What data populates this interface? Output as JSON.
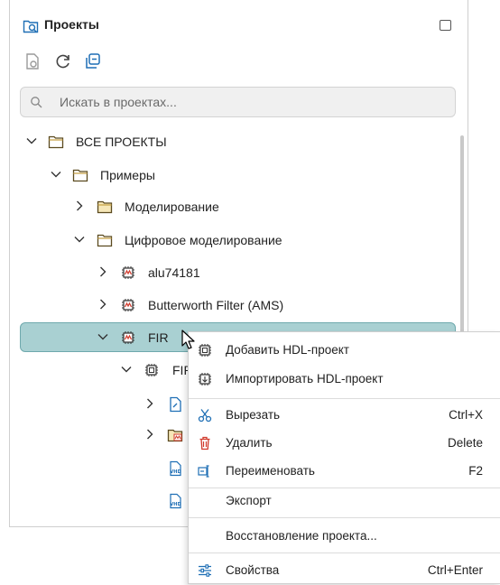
{
  "panel": {
    "title": "Проекты"
  },
  "search": {
    "placeholder": "Искать в проектах..."
  },
  "tree": [
    {
      "label": "ВСЕ ПРОЕКТЫ",
      "icon": "folder-icon",
      "expanded": true
    },
    {
      "label": "Примеры",
      "icon": "folder-icon",
      "expanded": true
    },
    {
      "label": "Моделирование",
      "icon": "folder-icon",
      "expanded": false
    },
    {
      "label": "Цифровое моделирование",
      "icon": "folder-icon",
      "expanded": true
    },
    {
      "label": "alu74181",
      "icon": "chip-wave-icon",
      "expanded": false
    },
    {
      "label": "Butterworth Filter  (AMS)",
      "icon": "chip-wave-icon",
      "expanded": false
    },
    {
      "label": "FIR",
      "icon": "chip-wave-icon",
      "expanded": true,
      "selected": true
    },
    {
      "label": "FIR",
      "icon": "chip-icon",
      "expanded": true
    },
    {
      "label": "",
      "icon": "document-icon",
      "expanded": false
    },
    {
      "label": "",
      "icon": "folder-wave-icon",
      "expanded": false
    },
    {
      "label": "",
      "icon": "vhd-file-icon"
    },
    {
      "label": "",
      "icon": "vhd-file-icon"
    }
  ],
  "context_menu": {
    "items": [
      {
        "label": "Добавить HDL-проект",
        "shortcut": "",
        "icon": "chip-add-icon"
      },
      {
        "label": "Импортировать HDL-проект",
        "shortcut": "",
        "icon": "chip-import-icon"
      },
      {
        "label": "Вырезать",
        "shortcut": "Ctrl+X",
        "icon": "scissors-icon"
      },
      {
        "label": "Удалить",
        "shortcut": "Delete",
        "icon": "trash-icon"
      },
      {
        "label": "Переименовать",
        "shortcut": "F2",
        "icon": "rename-icon"
      },
      {
        "label": "Экспорт",
        "shortcut": "",
        "icon": "",
        "submenu_arrow": "›"
      },
      {
        "label": "Восстановление проекта...",
        "shortcut": "",
        "icon": ""
      },
      {
        "label": "Свойства",
        "shortcut": "Ctrl+Enter",
        "icon": "sliders-icon"
      }
    ]
  },
  "colors": {
    "selection": "#a9d0d2",
    "selection_border": "#6fa9ad",
    "folder": "#c9a44a",
    "danger": "#d1392b",
    "accent": "#1f6fb5"
  }
}
